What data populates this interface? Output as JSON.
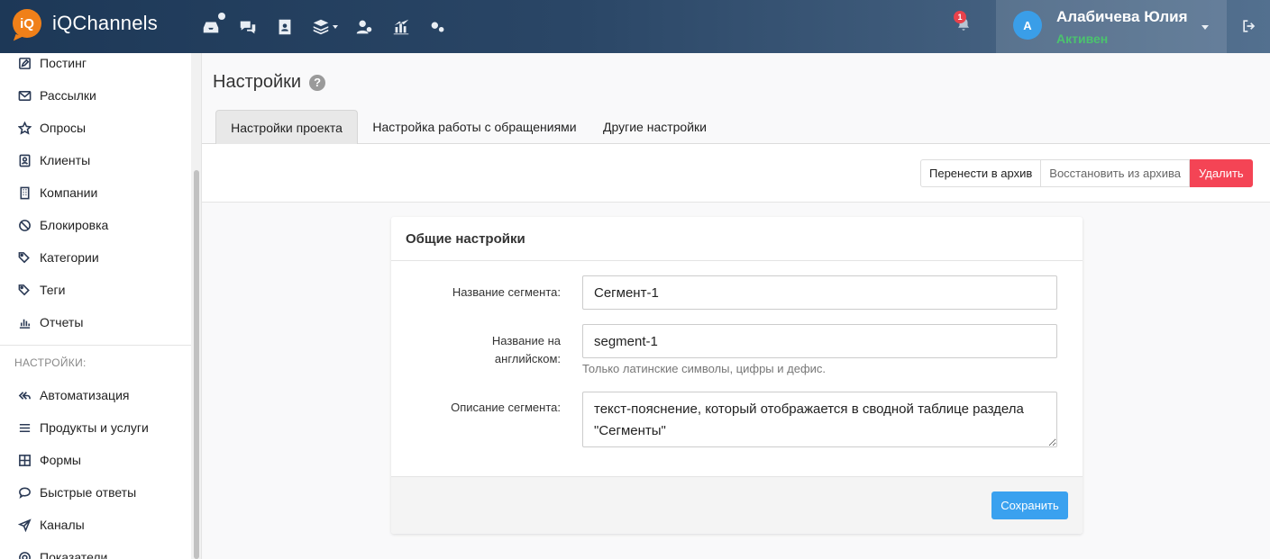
{
  "brand": {
    "logo_mark": "iQ",
    "name": "iQChannels"
  },
  "topnav": {
    "icons": [
      "inbox-icon",
      "chat-icon",
      "contacts-icon",
      "layers-icon",
      "users-settings-icon",
      "analytics-icon",
      "settings-icon"
    ],
    "notifications_count": "1",
    "user": {
      "initial": "А",
      "name": "Алабичева Юлия",
      "status": "Активен"
    }
  },
  "sidebar": {
    "items": [
      {
        "label": "Постинг",
        "icon": "edit-icon"
      },
      {
        "label": "Рассылки",
        "icon": "mail-icon"
      },
      {
        "label": "Опросы",
        "icon": "star-icon"
      },
      {
        "label": "Клиенты",
        "icon": "contact-card-icon"
      },
      {
        "label": "Компании",
        "icon": "building-icon"
      },
      {
        "label": "Блокировка",
        "icon": "ban-icon"
      },
      {
        "label": "Категории",
        "icon": "tag-icon"
      },
      {
        "label": "Теги",
        "icon": "tag-icon"
      },
      {
        "label": "Отчеты",
        "icon": "bar-chart-icon"
      }
    ],
    "section_label": "НАСТРОЙКИ:",
    "settings_items": [
      {
        "label": "Автоматизация",
        "icon": "reply-all-icon"
      },
      {
        "label": "Продукты и услуги",
        "icon": "list-icon"
      },
      {
        "label": "Формы",
        "icon": "table-icon"
      },
      {
        "label": "Быстрые ответы",
        "icon": "comment-icon"
      },
      {
        "label": "Каналы",
        "icon": "send-icon"
      },
      {
        "label": "Показатели",
        "icon": "target-icon"
      }
    ]
  },
  "page": {
    "title": "Настройки"
  },
  "tabs": [
    {
      "label": "Настройки проекта",
      "active": true
    },
    {
      "label": "Настройка работы с обращениями",
      "active": false
    },
    {
      "label": "Другие настройки",
      "active": false
    }
  ],
  "actions": {
    "archive": "Перенести в архив",
    "restore": "Восстановить из архива",
    "delete": "Удалить"
  },
  "form": {
    "header": "Общие настройки",
    "segment_name_label": "Название сегмента:",
    "segment_name_value": "Сегмент-1",
    "english_name_label_line1": "Название на",
    "english_name_label_line2": "английском:",
    "english_name_value": "segment-1",
    "english_name_help": "Только латинские символы, цифры и дефис.",
    "description_label": "Описание сегмента:",
    "description_value": "текст-пояснение, который отображается в сводной таблице раздела \"Сегменты\"",
    "save": "Сохранить"
  },
  "colors": {
    "navbar_start": "#1d3857",
    "navbar_end": "#53708f",
    "brand_orange": "#f08019",
    "status_green": "#4bc36e",
    "danger": "#f44455",
    "primary": "#3aa1ef"
  }
}
